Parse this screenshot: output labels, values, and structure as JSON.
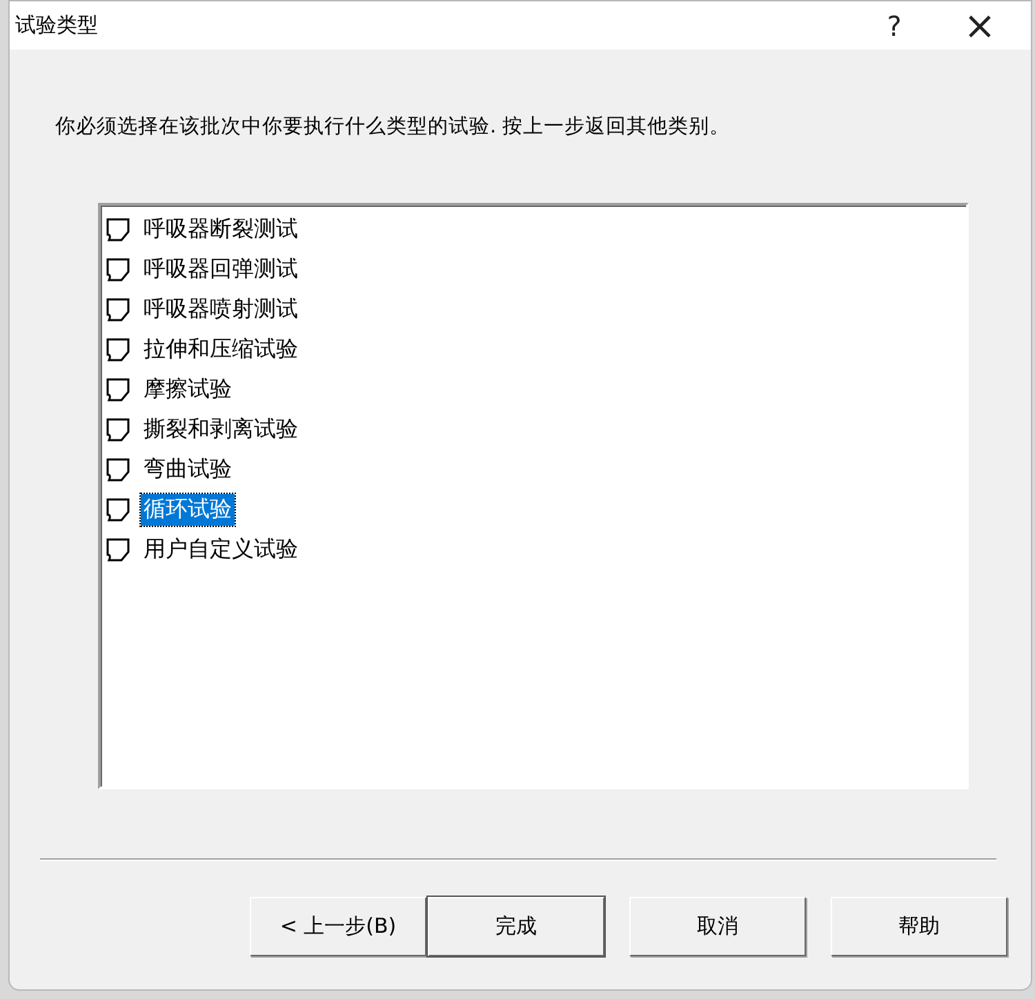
{
  "window": {
    "title": "试验类型",
    "help": "?",
    "close": "×"
  },
  "instruction": "你必须选择在该批次中你要执行什么类型的试验. 按上一步返回其他类别。",
  "test_types": [
    {
      "label": "呼吸器断裂测试",
      "selected": false
    },
    {
      "label": "呼吸器回弹测试",
      "selected": false
    },
    {
      "label": "呼吸器喷射测试",
      "selected": false
    },
    {
      "label": "拉伸和压缩试验",
      "selected": false
    },
    {
      "label": "摩擦试验",
      "selected": false
    },
    {
      "label": "撕裂和剥离试验",
      "selected": false
    },
    {
      "label": "弯曲试验",
      "selected": false
    },
    {
      "label": "循环试验",
      "selected": true
    },
    {
      "label": "用户自定义试验",
      "selected": false
    }
  ],
  "buttons": [
    {
      "label": "< 上一步(B)",
      "default": false
    },
    {
      "label": "完成",
      "default": true
    },
    {
      "label": "取消",
      "default": false
    },
    {
      "label": "帮助",
      "default": false
    }
  ]
}
